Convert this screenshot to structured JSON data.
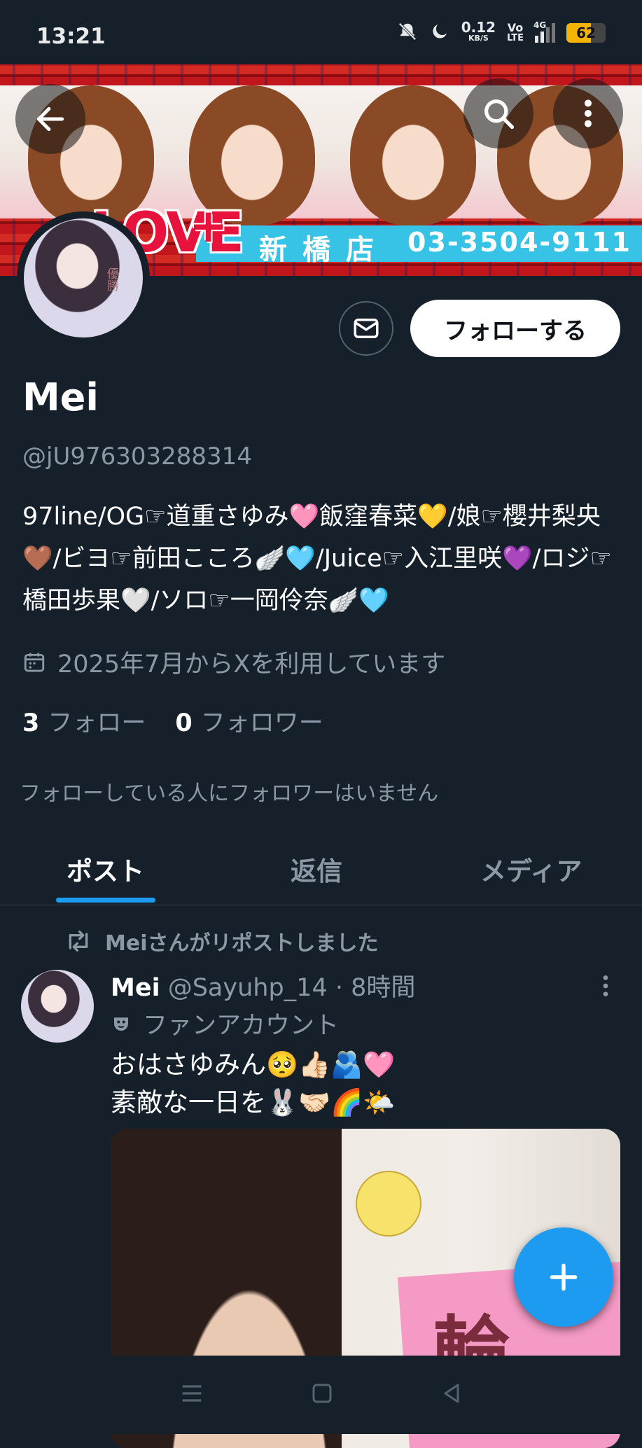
{
  "status_bar": {
    "time": "13:21",
    "net_speed_value": "0.12",
    "net_speed_unit": "KB/S",
    "volte_top": "Vo",
    "volte_bottom": "LTE",
    "network": "4G",
    "battery": "62",
    "battery_level": 0.62
  },
  "banner": {
    "logo": "LOVE",
    "logo_plus": "+",
    "shop": "新橋店",
    "phone": "03-3504-9111"
  },
  "profile": {
    "name": "Mei",
    "handle": "@jU976303288314",
    "bio": "97line/OG☞道重さゆみ🩷飯窪春菜💛/娘☞櫻井梨央🤎/ビヨ☞前田こころ🪽🩵/Juice☞入江里咲💜/ロジ☞橋田歩果🤍/ソロ☞一岡伶奈🪽🩵",
    "joined": "2025年7月からXを利用しています",
    "following_count": "3",
    "following_label": "フォロー",
    "followers_count": "0",
    "followers_label": "フォロワー",
    "no_followers_note": "フォローしている人にフォロワーはいません",
    "follow_button": "フォローする"
  },
  "tabs": [
    {
      "label": "ポスト",
      "active": true
    },
    {
      "label": "返信",
      "active": false
    },
    {
      "label": "メディア",
      "active": false
    }
  ],
  "post": {
    "repost_label": "Meiさんがリポストしました",
    "author_name": "Mei",
    "author_meta": "@Sayuhp_14 · 8時間",
    "fan_label": "ファンアカウント",
    "text_line1": "おはさゆみん🥺👍🏻🫂🩷",
    "text_line2": "素敵な一日を🐰🤝🏻🌈🌤️",
    "media_kanji": "輪"
  },
  "icons": {
    "back": "arrow-left-icon",
    "search": "search-icon",
    "more": "more-vertical-icon",
    "message": "mail-icon",
    "calendar": "calendar-icon",
    "repost": "repost-icon",
    "fan": "mask-icon",
    "compose": "plus-icon"
  },
  "colors": {
    "background": "#15202b",
    "accent": "#1d9bf0",
    "text_secondary": "#8b98a5"
  }
}
